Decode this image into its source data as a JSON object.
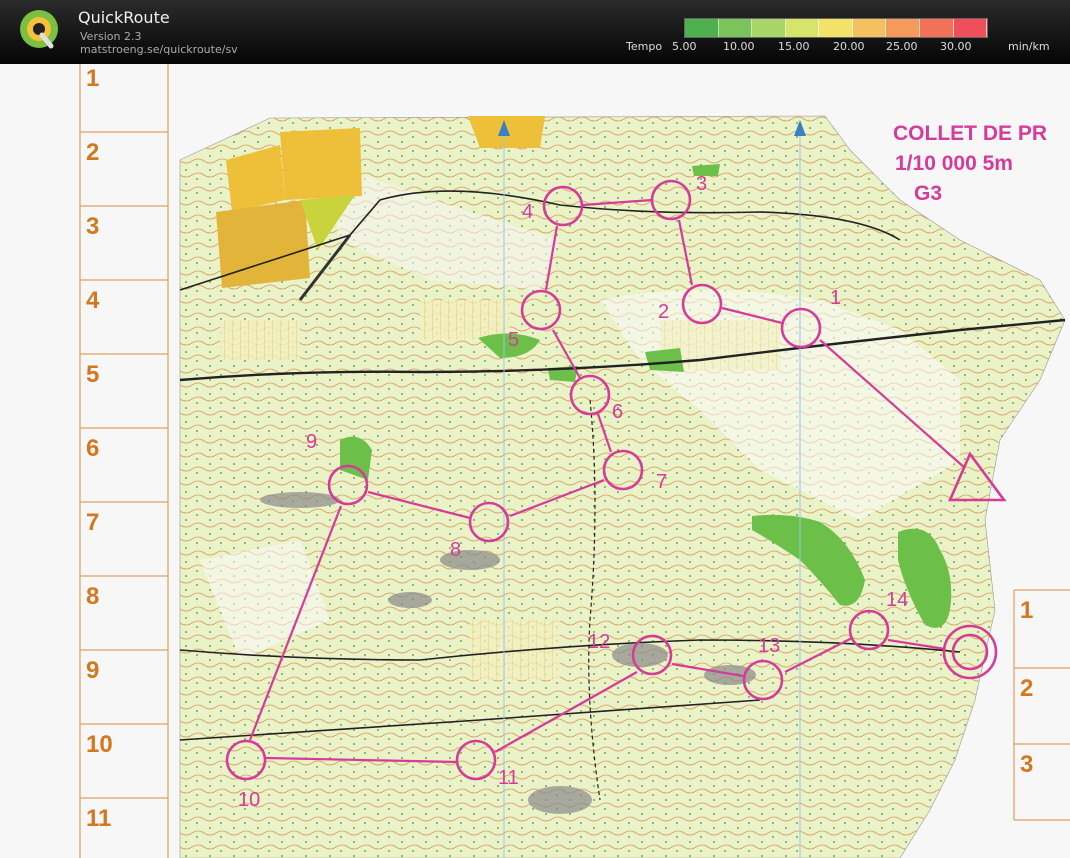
{
  "app": {
    "title": "QuickRoute",
    "version": "Version 2.3",
    "url": "matstroeng.se/quickroute/sv"
  },
  "legend": {
    "label": "Tempo",
    "unit": "min/km",
    "ticks": [
      "5.00",
      "10.00",
      "15.00",
      "20.00",
      "25.00",
      "30.00"
    ],
    "colors": [
      "#4fb04f",
      "#7bc45c",
      "#a9d467",
      "#d6e46a",
      "#f2e26a",
      "#f4c060",
      "#f49a5a",
      "#f27258",
      "#ef4e5a"
    ]
  },
  "map": {
    "event_title": "COLLET DE PR",
    "scale_line": "1/10 000  5m",
    "class": "G3",
    "controls": [
      "1",
      "2",
      "3",
      "4",
      "5",
      "6",
      "7",
      "8",
      "9",
      "10",
      "11",
      "12",
      "13",
      "14"
    ],
    "left_column": [
      "1",
      "2",
      "3",
      "4",
      "5",
      "6",
      "7",
      "8",
      "9",
      "10",
      "11"
    ],
    "right_column": [
      "1",
      "2",
      "3"
    ],
    "accent_color": "#d63b9a",
    "grid_label_color": "#d4781e"
  }
}
